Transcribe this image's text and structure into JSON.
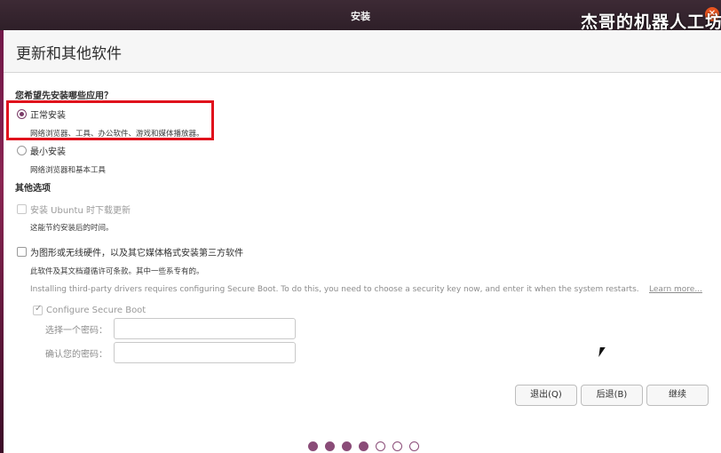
{
  "window": {
    "title": "安装",
    "watermark": "杰哥的机器人工坊"
  },
  "page": {
    "heading": "更新和其他软件"
  },
  "install_type": {
    "question": "您希望先安装哪些应用？",
    "options": [
      {
        "label": "正常安装",
        "description": "网络浏览器、工具、办公软件、游戏和媒体播放器。",
        "selected": true
      },
      {
        "label": "最小安装",
        "description": "网络浏览器和基本工具",
        "selected": false
      }
    ]
  },
  "other_options": {
    "heading": "其他选项",
    "download_updates": {
      "label": "安装 Ubuntu 时下载更新",
      "description": "这能节约安装后的时间。",
      "checked": false,
      "enabled": false
    },
    "third_party": {
      "label": "为图形或无线硬件，以及其它媒体格式安装第三方软件",
      "description": "此软件及其文档遵循许可条款。其中一些系专有的。",
      "checked": false
    },
    "secure_boot_info": "Installing third-party drivers requires configuring Secure Boot. To do this, you need to choose a security key now, and enter it when the system restarts.",
    "learn_more": "Learn more...",
    "configure_secure_boot": {
      "label": "Configure Secure Boot",
      "checked": true,
      "enabled": false
    },
    "password_label": "选择一个密码：",
    "confirm_label": "确认您的密码："
  },
  "buttons": {
    "quit": "退出(Q)",
    "back": "后退(B)",
    "continue": "继续"
  },
  "progress": {
    "total_steps": 7,
    "completed_steps": 4
  },
  "colors": {
    "accent": "#7a3a67",
    "highlight_box": "#e0101c",
    "close_button": "#e9541f"
  }
}
